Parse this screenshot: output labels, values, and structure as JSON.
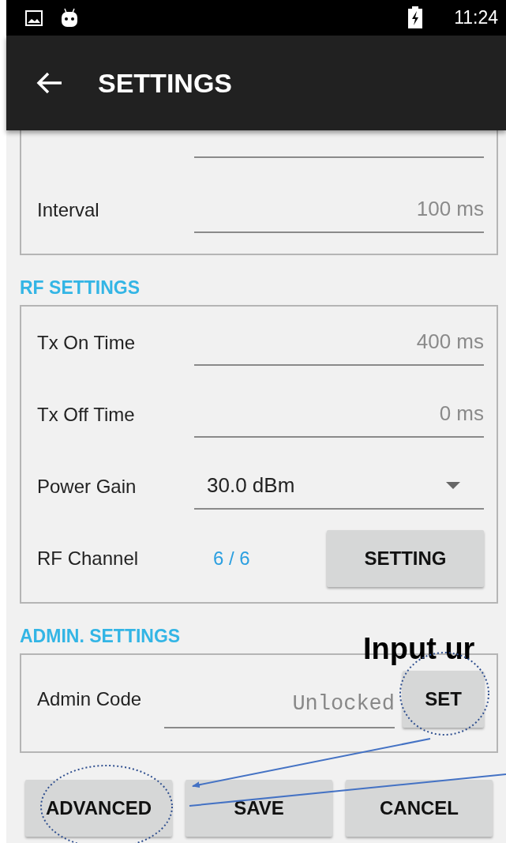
{
  "status_bar": {
    "time": "11:24"
  },
  "app_bar": {
    "title": "SETTINGS"
  },
  "sections": [
    {
      "rows": [
        {
          "kind": "clipped"
        },
        {
          "kind": "text",
          "label": "Interval",
          "value": "100 ms"
        }
      ]
    },
    {
      "title": "RF SETTINGS",
      "rows": [
        {
          "kind": "text",
          "label": "Tx On Time",
          "value": "400 ms"
        },
        {
          "kind": "text",
          "label": "Tx Off Time",
          "value": "0 ms"
        },
        {
          "kind": "dropdown",
          "label": "Power Gain",
          "value": "30.0 dBm"
        },
        {
          "kind": "channel",
          "label": "RF Channel",
          "value": "6 / 6",
          "button": "SETTING"
        }
      ]
    },
    {
      "title": "ADMIN. SETTINGS",
      "rows": [
        {
          "kind": "code",
          "label": "Admin Code",
          "value": "Unlocked",
          "button": "SET"
        }
      ]
    }
  ],
  "buttons": [
    "ADVANCED",
    "SAVE",
    "CANCEL"
  ],
  "annotation": {
    "callout": "Input ur"
  }
}
